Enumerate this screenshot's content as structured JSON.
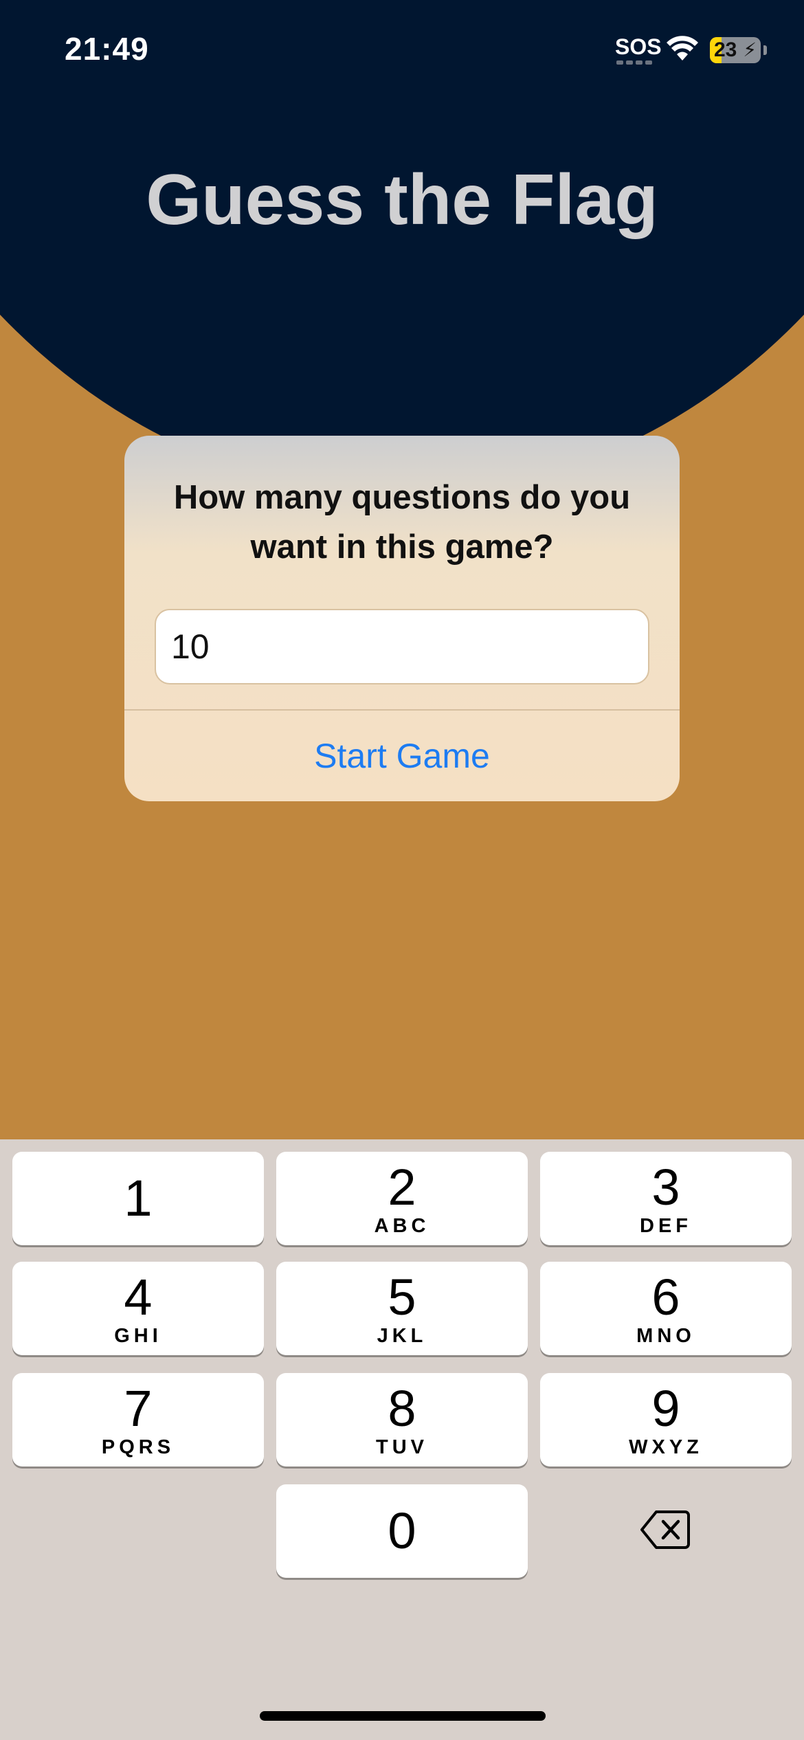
{
  "status_bar": {
    "time": "21:49",
    "sos_label": "SOS",
    "battery_level": "23",
    "battery_fill_percent": 23,
    "battery_charging_icon": "bolt-icon",
    "wifi_icon": "wifi-icon"
  },
  "app": {
    "title": "Guess the Flag"
  },
  "alert": {
    "message": "How many questions do you want in this game?",
    "input_value": "10",
    "button_label": "Start Game"
  },
  "keypad": {
    "keys": [
      {
        "digit": "1",
        "letters": ""
      },
      {
        "digit": "2",
        "letters": "ABC"
      },
      {
        "digit": "3",
        "letters": "DEF"
      },
      {
        "digit": "4",
        "letters": "GHI"
      },
      {
        "digit": "5",
        "letters": "JKL"
      },
      {
        "digit": "6",
        "letters": "MNO"
      },
      {
        "digit": "7",
        "letters": "PQRS"
      },
      {
        "digit": "8",
        "letters": "TUV"
      },
      {
        "digit": "9",
        "letters": "WXYZ"
      },
      {
        "digit": "0",
        "letters": ""
      }
    ],
    "delete_icon": "backspace-icon"
  },
  "colors": {
    "background": "#c0873e",
    "top_arc": "#011630",
    "title": "#d0d0d2",
    "accent": "#1d7cf2",
    "keypad_bg": "#d8d0cb",
    "battery": "#ffd60a"
  }
}
